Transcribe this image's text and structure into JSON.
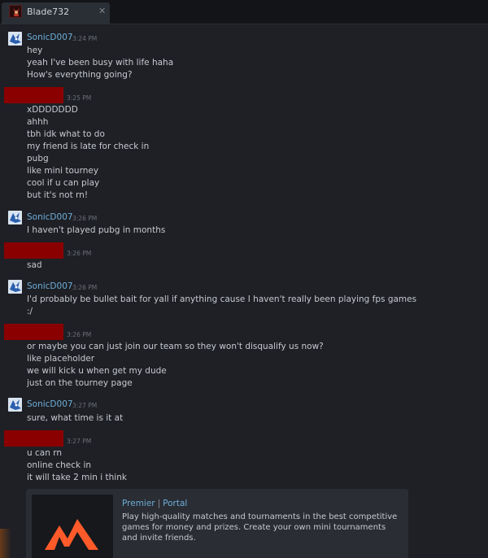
{
  "tab": {
    "title": "Blade732",
    "close": "✕",
    "avatar_icon": "dark-portrait-icon"
  },
  "messages": [
    {
      "sender": "SonicD007",
      "time": "3:24 PM",
      "lines": [
        "hey",
        "yeah I've been busy with life haha",
        "How's everything going?"
      ]
    },
    {
      "sender": "",
      "time": "3:25 PM",
      "lines": [
        "xDDDDDDD",
        "ahhh",
        "tbh idk what to do",
        "my friend is late for check in",
        "pubg",
        "like mini tourney",
        "cool if u can play",
        "but it's not rn!"
      ]
    },
    {
      "sender": "SonicD007",
      "time": "3:26 PM",
      "lines": [
        "I haven't played pubg in months"
      ]
    },
    {
      "sender": "",
      "time": "3:26 PM",
      "lines": [
        "sad"
      ]
    },
    {
      "sender": "SonicD007",
      "time": "3:26 PM",
      "lines": [
        "I'd probably be bullet bait for yall if anything cause I haven't really been playing fps games",
        ":/"
      ]
    },
    {
      "sender": "",
      "time": "3:26 PM",
      "lines": [
        "or maybe you can just join our team so they won't disqualify us now?",
        "like placeholder",
        "we will kick u when get my dude",
        "just on the tourney page"
      ]
    },
    {
      "sender": "SonicD007",
      "time": "3:27 PM",
      "lines": [
        "sure, what time is it at"
      ]
    },
    {
      "sender": "",
      "time": "3:27 PM",
      "lines": [
        "u can rn",
        "online check in",
        "it will take 2 min i think"
      ]
    }
  ],
  "embed": {
    "title_part1": "Premier",
    "title_sep": "|",
    "title_part2": "Portal",
    "description": "Play high-quality matches and tournaments in the best competitive games for money and prizes. Create your own mini tournaments and invite friends.",
    "logo_icon": "premier-logo-icon",
    "accent": "#ff5a2a"
  },
  "colors": {
    "username": "#6dadd8",
    "redaction": "#8a0000",
    "background": "#1e2025"
  }
}
